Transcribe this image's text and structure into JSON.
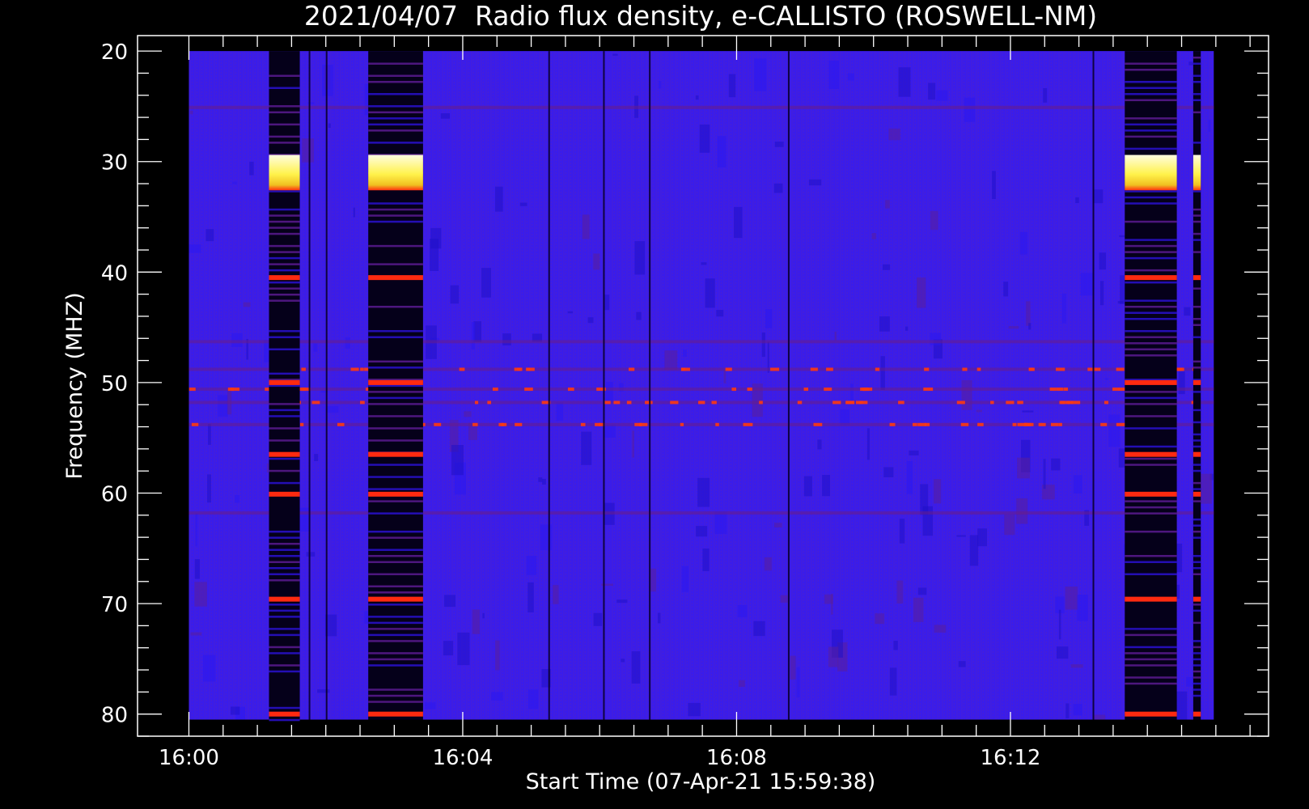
{
  "chart_data": {
    "type": "heatmap",
    "title": "2021/04/07  Radio flux density, e-CALLISTO (ROSWELL-NM)",
    "xlabel": "Start Time (07-Apr-21 15:59:38)",
    "ylabel": "Frequency (MHZ)",
    "x_ticks": [
      "16:00",
      "16:04",
      "16:08",
      "16:12"
    ],
    "x_tick_minutes": [
      0,
      4,
      8,
      12
    ],
    "xlim_minutes": [
      -0.75,
      15.77
    ],
    "data_xlim_minutes": [
      0,
      14.97
    ],
    "y_ticks": [
      20,
      30,
      40,
      50,
      60,
      70,
      80
    ],
    "ylim": [
      18.6,
      82.0
    ],
    "data_ylim": [
      20,
      80.5
    ],
    "y_inverted": true,
    "colors": {
      "background": "#000000",
      "base": "#3a1aeb",
      "bright": "#fffb60",
      "hot": "#ff2a10",
      "dark": "#05001a"
    },
    "bursts": [
      {
        "t0": 1.17,
        "t1": 1.62,
        "f0": 29.4,
        "f1": 32.6
      },
      {
        "t0": 2.62,
        "t1": 3.42,
        "f0": 29.4,
        "f1": 32.6
      },
      {
        "t0": 13.67,
        "t1": 14.43,
        "f0": 29.4,
        "f1": 32.6
      },
      {
        "t0": 14.67,
        "t1": 14.78,
        "f0": 29.4,
        "f1": 32.6
      }
    ],
    "dark_bands": [
      {
        "t0": 1.17,
        "t1": 1.62
      },
      {
        "t0": 2.62,
        "t1": 3.42
      },
      {
        "t0": 13.67,
        "t1": 14.43
      },
      {
        "t0": 14.67,
        "t1": 14.78
      }
    ],
    "hot_lines_mhz": [
      40.5,
      50.0,
      56.5,
      60.1,
      69.6,
      80.0
    ],
    "narrowband_rfi_mhz": [
      48.8,
      50.6,
      51.8,
      53.8,
      25.1,
      46.3,
      61.8
    ]
  }
}
